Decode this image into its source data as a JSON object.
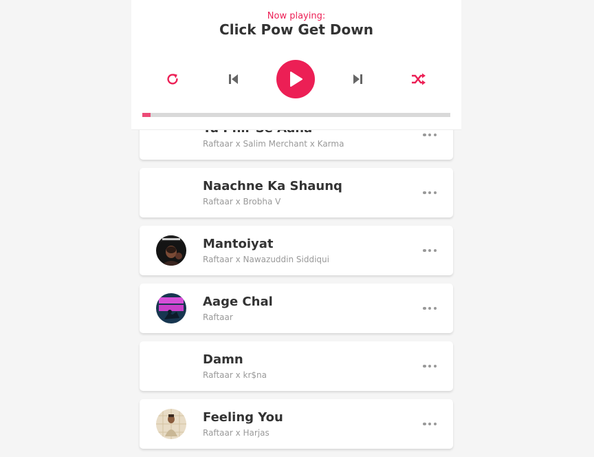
{
  "player": {
    "now_playing_label": "Now playing:",
    "current_title": "Click Pow Get Down",
    "progress": 0.027,
    "accent_color": "#ec1f55",
    "controls": [
      {
        "name": "repeat-button",
        "icon": "repeat-icon"
      },
      {
        "name": "previous-button",
        "icon": "skip-back-icon"
      },
      {
        "name": "play-button",
        "icon": "play-icon"
      },
      {
        "name": "next-button",
        "icon": "skip-forward-icon"
      },
      {
        "name": "shuffle-button",
        "icon": "shuffle-icon"
      }
    ]
  },
  "playlist": [
    {
      "title": "Tu Phir Se Aana",
      "artist": "Raftaar x Salim Merchant x Karma",
      "cover": "none"
    },
    {
      "title": "Naachne Ka Shaunq",
      "artist": "Raftaar x Brobha V",
      "cover": "none"
    },
    {
      "title": "Mantoiyat",
      "artist": "Raftaar x Nawazuddin Siddiqui",
      "cover": "mantoiyat-cover"
    },
    {
      "title": "Aage Chal",
      "artist": "Raftaar",
      "cover": "aage-chal-cover"
    },
    {
      "title": "Damn",
      "artist": "Raftaar x kr$na",
      "cover": "none"
    },
    {
      "title": "Feeling You",
      "artist": "Raftaar x Harjas",
      "cover": "feeling-you-cover"
    }
  ],
  "options_icon": "more-horizontal-icon"
}
